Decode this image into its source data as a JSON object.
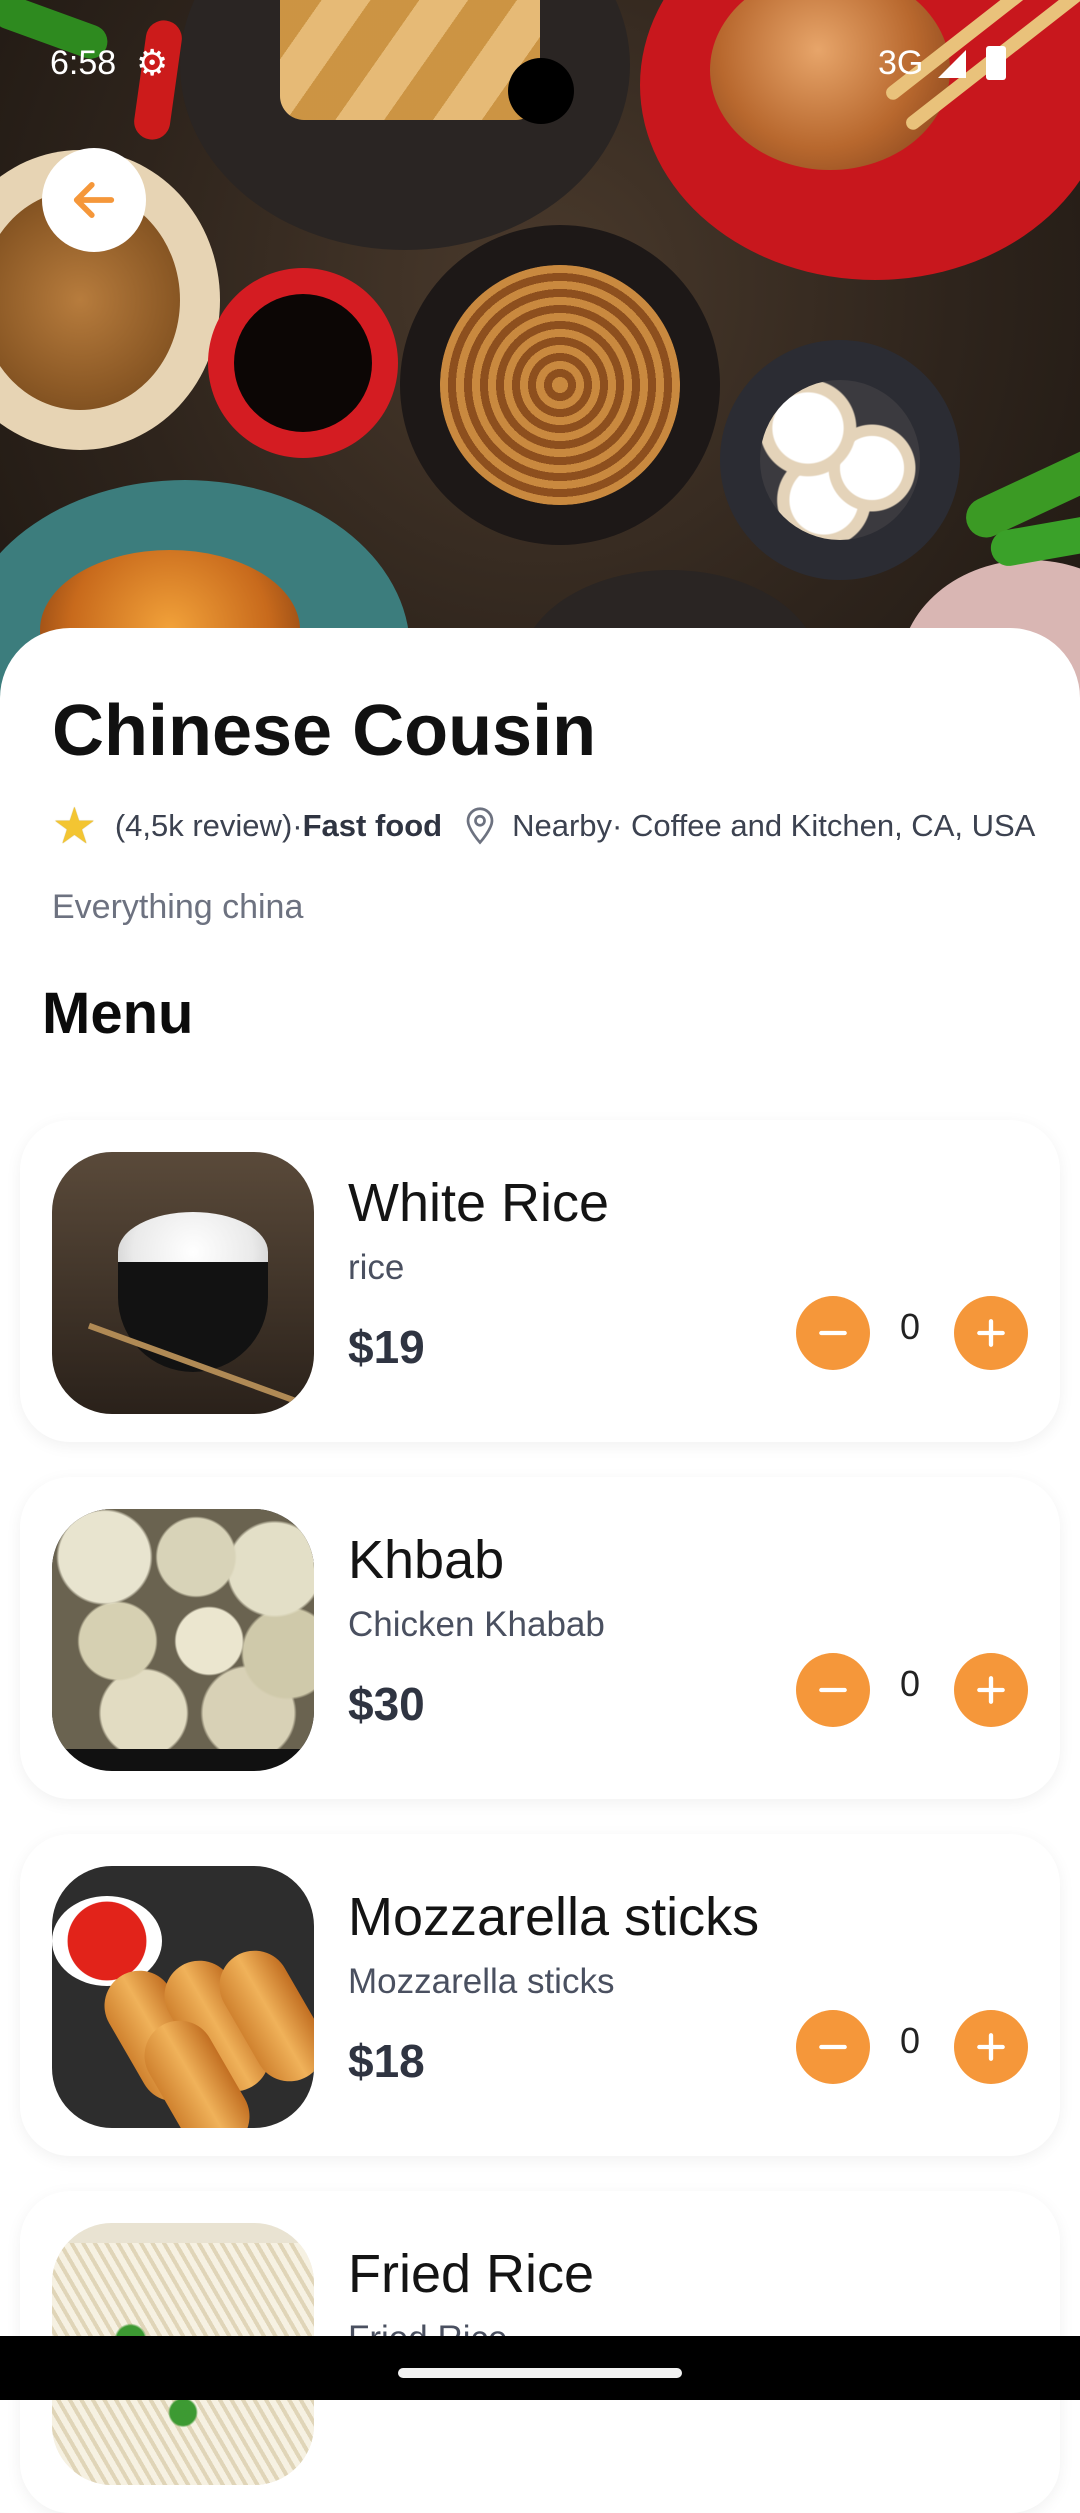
{
  "status_bar": {
    "time": "6:58",
    "network": "3G"
  },
  "restaurant": {
    "name": "Chinese Cousin",
    "reviews": "(4,5k review)",
    "separator": "·",
    "category": "Fast food",
    "location": "Nearby· Coffee and Kitchen, CA, USA",
    "tagline": "Everything china"
  },
  "menu": {
    "heading": "Menu",
    "items": [
      {
        "name": "White Rice",
        "description": "rice",
        "price": "$19",
        "quantity": "0"
      },
      {
        "name": "Khbab",
        "description": "Chicken Khabab",
        "price": "$30",
        "quantity": "0"
      },
      {
        "name": "Mozzarella sticks",
        "description": "Mozzarella sticks",
        "price": "$18",
        "quantity": "0"
      },
      {
        "name": "Fried Rice",
        "description": "Fried Rice",
        "price": "",
        "quantity": ""
      }
    ]
  },
  "icons": {
    "back": "arrow-left-icon",
    "rating": "star-icon",
    "location": "map-pin-icon",
    "decrease": "minus-icon",
    "increase": "plus-icon"
  },
  "colors": {
    "accent": "#f5973a",
    "star": "#f3c532",
    "price": "#2f3441"
  }
}
